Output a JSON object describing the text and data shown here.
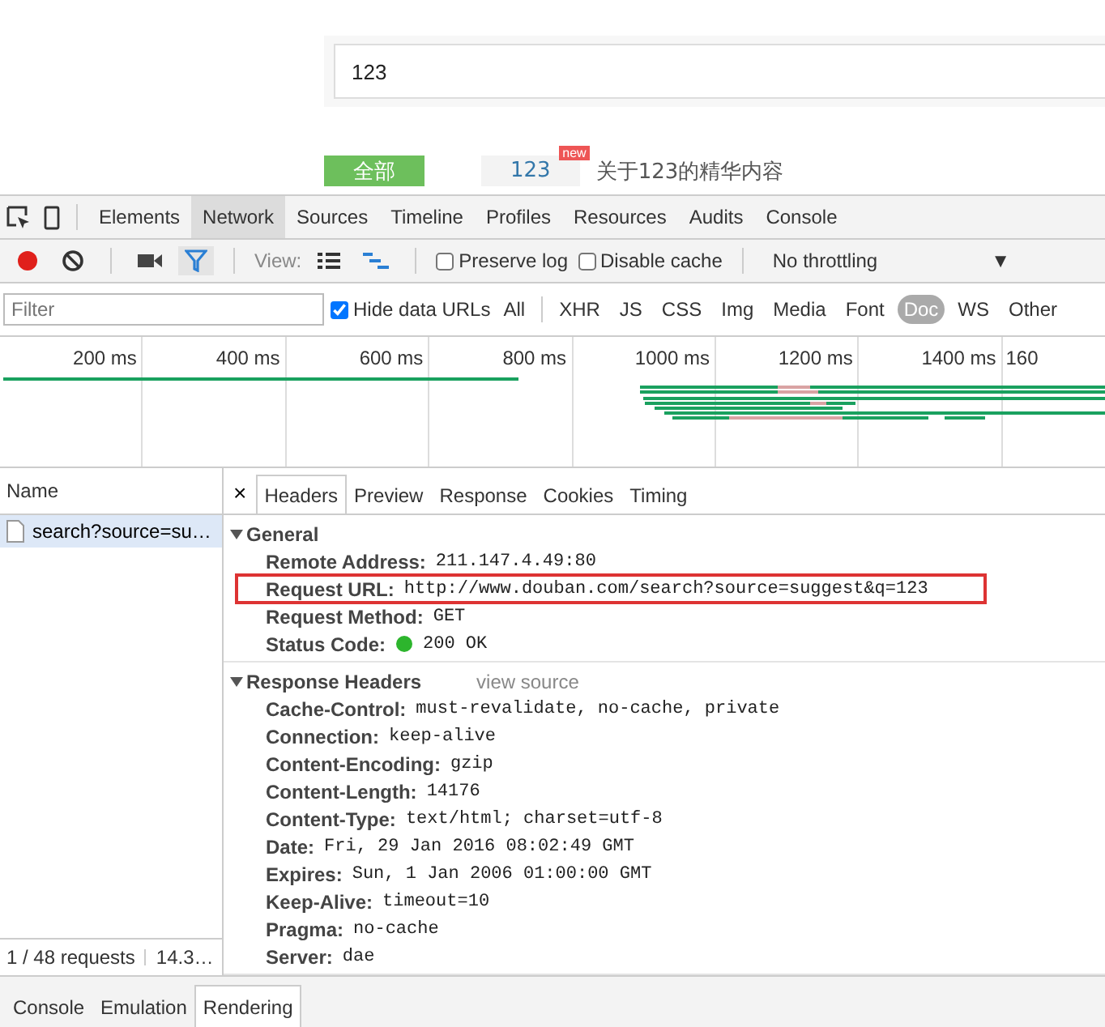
{
  "page": {
    "search_value": "123",
    "tabs": [
      {
        "label": "全部",
        "selected": true
      },
      {
        "label": "123",
        "selected": false,
        "badge": "new"
      }
    ],
    "subtitle": "关于123的精华内容"
  },
  "devtools": {
    "tabs": [
      {
        "label": "Elements",
        "selected": false
      },
      {
        "label": "Network",
        "selected": true
      },
      {
        "label": "Sources",
        "selected": false
      },
      {
        "label": "Timeline",
        "selected": false
      },
      {
        "label": "Profiles",
        "selected": false
      },
      {
        "label": "Resources",
        "selected": false
      },
      {
        "label": "Audits",
        "selected": false
      },
      {
        "label": "Console",
        "selected": false
      }
    ]
  },
  "toolbar": {
    "recording": true,
    "filter_active": true,
    "view_label": "View:",
    "preserve_log": {
      "label": "Preserve log",
      "checked": false
    },
    "disable_cache": {
      "label": "Disable cache",
      "checked": false
    },
    "throttling": "No throttling",
    "dropdown_arrow": "▼"
  },
  "filter_bar": {
    "placeholder": "Filter",
    "hide_data_urls": {
      "label": "Hide data URLs",
      "checked": true
    },
    "types": [
      {
        "label": "All",
        "selected": false
      },
      {
        "label": "XHR",
        "selected": false
      },
      {
        "label": "JS",
        "selected": false
      },
      {
        "label": "CSS",
        "selected": false
      },
      {
        "label": "Img",
        "selected": false
      },
      {
        "label": "Media",
        "selected": false
      },
      {
        "label": "Font",
        "selected": false
      },
      {
        "label": "Doc",
        "selected": true
      },
      {
        "label": "WS",
        "selected": false
      },
      {
        "label": "Other",
        "selected": false
      }
    ]
  },
  "overview": {
    "ticks": [
      "200 ms",
      "400 ms",
      "600 ms",
      "800 ms",
      "1000 ms",
      "1200 ms",
      "1400 ms",
      "160"
    ]
  },
  "requests": {
    "column": "Name",
    "rows": [
      {
        "name": "search?source=su…",
        "selected": true
      }
    ],
    "status": "1 / 48 requests",
    "status_size": "14.3…"
  },
  "detail": {
    "close": "×",
    "tabs": [
      {
        "label": "Headers",
        "selected": true
      },
      {
        "label": "Preview",
        "selected": false
      },
      {
        "label": "Response",
        "selected": false
      },
      {
        "label": "Cookies",
        "selected": false
      },
      {
        "label": "Timing",
        "selected": false
      }
    ],
    "sections": [
      {
        "title": "General",
        "expanded": true,
        "rows": [
          {
            "name": "Remote Address:",
            "value": "211.147.4.49:80",
            "kind": "plain",
            "highlighted": false
          },
          {
            "name": "Request URL:",
            "value": "http://www.douban.com/search?source=suggest&q=123",
            "kind": "plain",
            "highlighted": true
          },
          {
            "name": "Request Method:",
            "value": "GET",
            "kind": "plain",
            "highlighted": false
          },
          {
            "name": "Status Code:",
            "value": "200 OK",
            "kind": "status",
            "highlighted": false
          }
        ]
      },
      {
        "title": "Response Headers",
        "expanded": true,
        "link": "view source",
        "rows": [
          {
            "name": "Cache-Control:",
            "value": "must-revalidate, no-cache, private",
            "kind": "plain",
            "highlighted": false
          },
          {
            "name": "Connection:",
            "value": "keep-alive",
            "kind": "plain",
            "highlighted": false
          },
          {
            "name": "Content-Encoding:",
            "value": "gzip",
            "kind": "plain",
            "highlighted": false
          },
          {
            "name": "Content-Length:",
            "value": "14176",
            "kind": "plain",
            "highlighted": false
          },
          {
            "name": "Content-Type:",
            "value": "text/html; charset=utf-8",
            "kind": "plain",
            "highlighted": false
          },
          {
            "name": "Date:",
            "value": "Fri, 29 Jan 2016 08:02:49 GMT",
            "kind": "plain",
            "highlighted": false
          },
          {
            "name": "Expires:",
            "value": "Sun, 1 Jan 2006 01:00:00 GMT",
            "kind": "plain",
            "highlighted": false
          },
          {
            "name": "Keep-Alive:",
            "value": "timeout=10",
            "kind": "plain",
            "highlighted": false
          },
          {
            "name": "Pragma:",
            "value": "no-cache",
            "kind": "plain",
            "highlighted": false
          },
          {
            "name": "Server:",
            "value": "dae",
            "kind": "plain",
            "highlighted": false
          }
        ]
      }
    ]
  },
  "drawer": {
    "tabs": [
      {
        "label": "Console",
        "selected": false
      },
      {
        "label": "Emulation",
        "selected": false
      },
      {
        "label": "Rendering",
        "selected": true
      }
    ]
  }
}
